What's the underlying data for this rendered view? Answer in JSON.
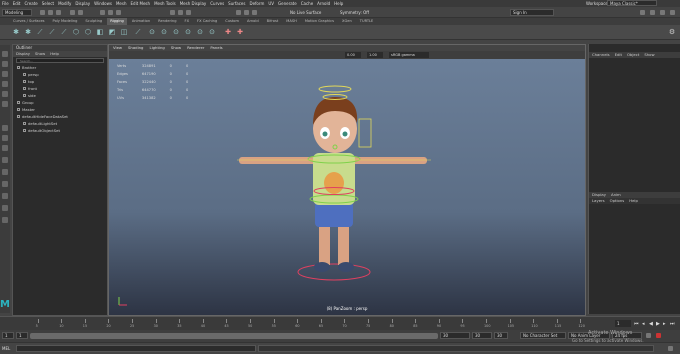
{
  "menubar": [
    "File",
    "Edit",
    "Create",
    "Select",
    "Modify",
    "Display",
    "Windows",
    "Mesh",
    "Edit Mesh",
    "Mesh Tools",
    "Mesh Display",
    "Curves",
    "Surfaces",
    "Deform",
    "UV",
    "Generate",
    "Cache",
    "Arnold",
    "Help"
  ],
  "workspace": {
    "label": "Workspace:",
    "value": "Maya Classic*"
  },
  "status": {
    "mode": "Modeling",
    "no_live_surface": "No Live Surface",
    "symmetry": "Symmetry: Off",
    "sign_in": "Sign In"
  },
  "shelf_tabs": [
    "Curves / Surfaces",
    "Poly Modeling",
    "Sculpting",
    "Rigging",
    "Animation",
    "Rendering",
    "FX",
    "FX Caching",
    "Custom",
    "Arnold",
    "Bifrost",
    "MASH",
    "Motion Graphics",
    "XGen",
    "TURTLE"
  ],
  "shelf_active": "Rigging",
  "outliner": {
    "title": "Outliner",
    "menu": [
      "Display",
      "Show",
      "Help"
    ],
    "search_placeholder": "Search...",
    "items": [
      {
        "label": "Brother",
        "indent": 0
      },
      {
        "label": "persp",
        "indent": 1
      },
      {
        "label": "top",
        "indent": 1
      },
      {
        "label": "front",
        "indent": 1
      },
      {
        "label": "side",
        "indent": 1
      },
      {
        "label": "Group",
        "indent": 0
      },
      {
        "label": "Master",
        "indent": 0
      },
      {
        "label": "defaultHideFaceDataSet",
        "indent": 0
      },
      {
        "label": "defaultLightSet",
        "indent": 1
      },
      {
        "label": "defaultObjectSet",
        "indent": 1
      }
    ]
  },
  "viewport": {
    "menu": [
      "View",
      "Shading",
      "Lighting",
      "Show",
      "Renderer",
      "Panels"
    ],
    "gamma": "sRGB gamma",
    "fields": [
      "0.00",
      "1.00"
    ],
    "hud": [
      {
        "label": "Verts",
        "v1": "324891",
        "v2": "0",
        "v3": "0"
      },
      {
        "label": "Edges",
        "v1": "647190",
        "v2": "0",
        "v3": "0"
      },
      {
        "label": "Faces",
        "v1": "322440",
        "v2": "0",
        "v3": "0"
      },
      {
        "label": "Tris",
        "v1": "644770",
        "v2": "0",
        "v3": "0"
      },
      {
        "label": "UVs",
        "v1": "341382",
        "v2": "0",
        "v3": "0"
      }
    ],
    "camera_label": "(8) PanZoom : persp"
  },
  "channel_box": {
    "menu": [
      "Channels",
      "Edit",
      "Object",
      "Show"
    ]
  },
  "layer_editor": {
    "tabs": [
      "Display",
      "Anim"
    ],
    "menu": [
      "Layers",
      "Options",
      "Help"
    ]
  },
  "timeline": {
    "ticks": [
      "5",
      "10",
      "15",
      "20",
      "25",
      "30",
      "35",
      "40",
      "45",
      "50",
      "55",
      "60",
      "65",
      "70",
      "75",
      "80",
      "85",
      "90",
      "95",
      "100",
      "105",
      "110",
      "115",
      "120"
    ],
    "current": "1"
  },
  "range": {
    "start": "1",
    "inner_start": "1",
    "inner_end": "30",
    "end": "30",
    "end2": "30",
    "character_set": "No Character Set",
    "anim_layer": "No Anim Layer",
    "fps": "24 fps"
  },
  "command": {
    "label": "MEL"
  },
  "watermark": {
    "line1": "Activate Windows",
    "line2": "Go to Settings to activate Windows."
  },
  "colors": {
    "accent": "#5d5d5d",
    "canvas_top": "#6b7f99",
    "canvas_bottom": "#2d3444",
    "ctrl_green": "#7fd14a",
    "ctrl_yellow": "#e2d85a",
    "ctrl_red": "#e04060"
  }
}
